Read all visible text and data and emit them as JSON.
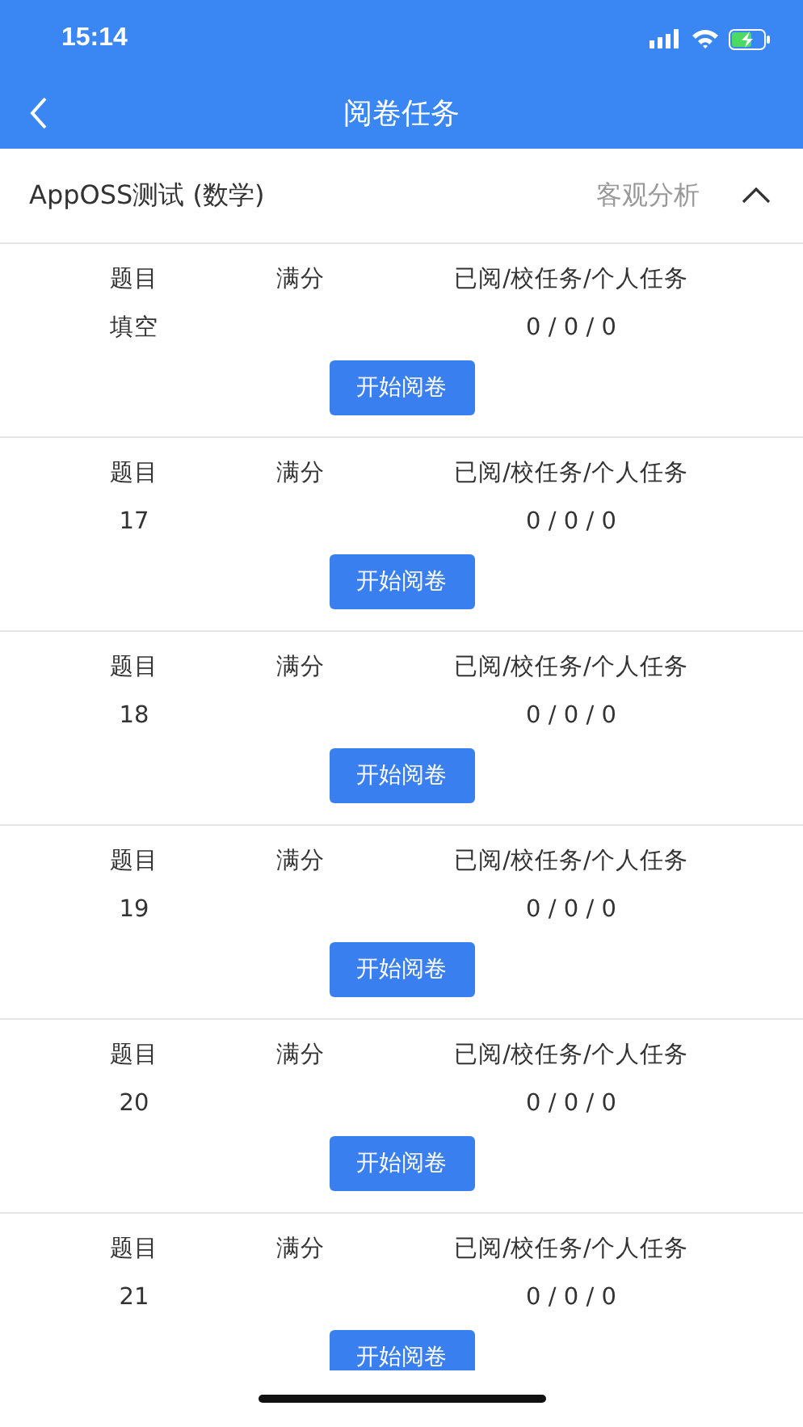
{
  "status_bar": {
    "time": "15:14",
    "charging": true
  },
  "nav": {
    "title": "阅卷任务"
  },
  "exam": {
    "title": "AppOSS测试 (数学)",
    "action": "客观分析",
    "expanded": true
  },
  "tasks": [
    {
      "columns": [
        "题目",
        "满分",
        "已阅/校任务/个人任务"
      ],
      "question": "填空",
      "progress": "0 / 0 / 0",
      "button": "开始阅卷"
    },
    {
      "columns": [
        "题目",
        "满分",
        "已阅/校任务/个人任务"
      ],
      "question": "17",
      "progress": "0 / 0 / 0",
      "button": "开始阅卷"
    },
    {
      "columns": [
        "题目",
        "满分",
        "已阅/校任务/个人任务"
      ],
      "question": "18",
      "progress": "0 / 0 / 0",
      "button": "开始阅卷"
    },
    {
      "columns": [
        "题目",
        "满分",
        "已阅/校任务/个人任务"
      ],
      "question": "19",
      "progress": "0 / 0 / 0",
      "button": "开始阅卷"
    },
    {
      "columns": [
        "题目",
        "满分",
        "已阅/校任务/个人任务"
      ],
      "question": "20",
      "progress": "0 / 0 / 0",
      "button": "开始阅卷"
    },
    {
      "columns": [
        "题目",
        "满分",
        "已阅/校任务/个人任务"
      ],
      "question": "21",
      "progress": "0 / 0 / 0",
      "button": "开始阅卷"
    }
  ]
}
